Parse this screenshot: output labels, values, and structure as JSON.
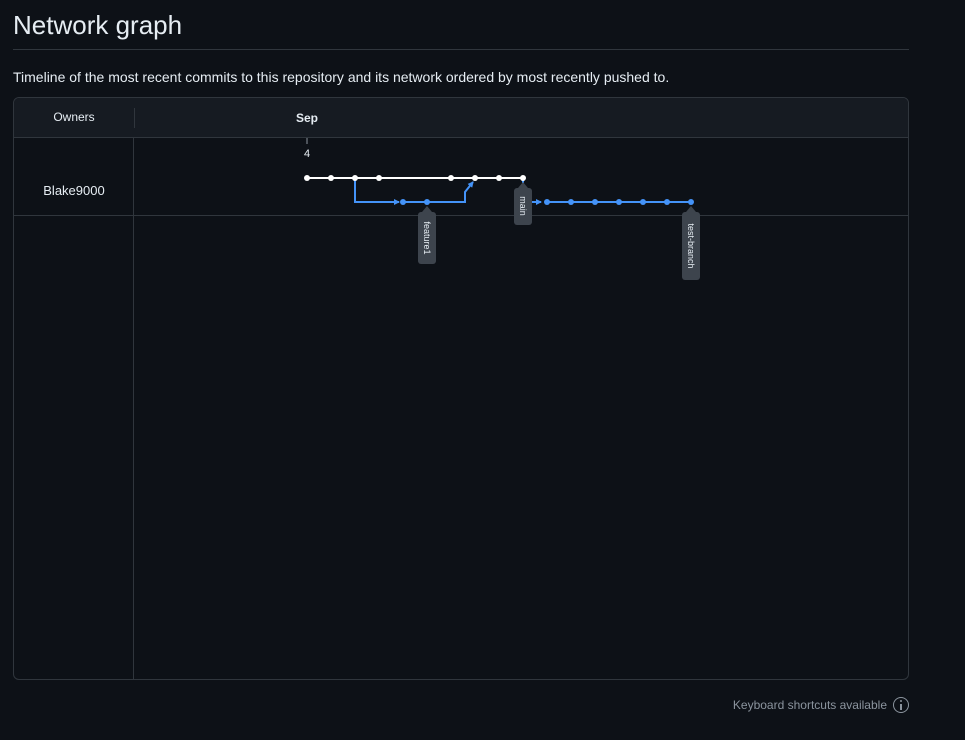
{
  "page": {
    "title": "Network graph",
    "description": "Timeline of the most recent commits to this repository and its network ordered by most recently pushed to."
  },
  "graph": {
    "owners_header": "Owners",
    "month_label": "Sep",
    "day_label": "4",
    "owners": [
      "Blake9000"
    ],
    "branches": [
      {
        "name": "main",
        "color": "#ffffff"
      },
      {
        "name": "feature1",
        "color": "#4493f8"
      },
      {
        "name": "test-branch",
        "color": "#4493f8"
      }
    ],
    "branch_labels": {
      "main": "main",
      "feature1": "feature1",
      "test_branch": "test-branch"
    }
  },
  "footer": {
    "shortcuts_label": "Keyboard shortcuts available",
    "icon": "info-icon"
  },
  "colors": {
    "background": "#0d1117",
    "header": "#161b22",
    "border": "#30363d",
    "main_branch": "#ffffff",
    "side_branch": "#4493f8",
    "label_bg": "#3d444d"
  }
}
